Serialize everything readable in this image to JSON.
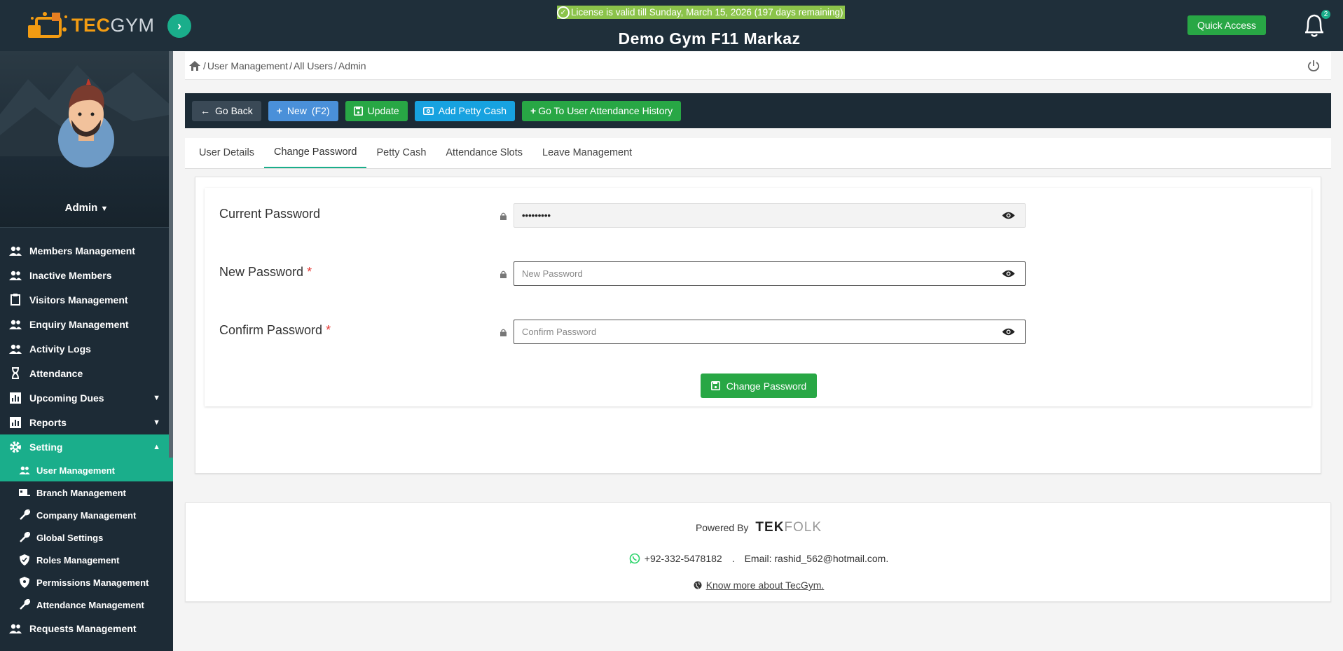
{
  "brand": {
    "logo_tec": "TEC",
    "logo_gym": "GYM",
    "accent": "#1aae8b",
    "orange": "#f39c12"
  },
  "topbar": {
    "license_text": "License is valid till Sunday, March 15, 2026 (197 days remaining)",
    "gym_name": "Demo Gym F11 Markaz",
    "quick_access": "Quick Access",
    "notification_count": "2"
  },
  "sidebar": {
    "user_name": "Admin",
    "items": [
      {
        "label": "Members Management",
        "icon": "users-icon"
      },
      {
        "label": "Inactive Members",
        "icon": "users-icon"
      },
      {
        "label": "Visitors Management",
        "icon": "clipboard-icon"
      },
      {
        "label": "Enquiry Management",
        "icon": "users-icon"
      },
      {
        "label": "Activity Logs",
        "icon": "users-icon"
      },
      {
        "label": "Attendance",
        "icon": "hourglass-icon"
      },
      {
        "label": "Upcoming Dues",
        "icon": "chart-icon"
      },
      {
        "label": "Reports",
        "icon": "chart-icon"
      },
      {
        "label": "Setting",
        "icon": "gear-icon"
      }
    ],
    "sub_items": [
      {
        "label": "User Management",
        "icon": "users-icon"
      },
      {
        "label": "Branch Management",
        "icon": "branch-icon"
      },
      {
        "label": "Company Management",
        "icon": "wrench-icon"
      },
      {
        "label": "Global Settings",
        "icon": "wrench-icon"
      },
      {
        "label": "Roles Management",
        "icon": "shield-icon"
      },
      {
        "label": "Permissions Management",
        "icon": "shield-icon"
      },
      {
        "label": "Attendance Management",
        "icon": "wrench-icon"
      }
    ],
    "last_item": {
      "label": "Requests Management",
      "icon": "users-icon"
    }
  },
  "breadcrumb": [
    "User Management",
    "All Users",
    "Admin"
  ],
  "toolbar": {
    "go_back": "Go Back",
    "new": "New",
    "new_shortcut": "(F2)",
    "update": "Update",
    "petty_cash": "Add Petty Cash",
    "history": "Go To User Attendance History"
  },
  "tabs": [
    "User Details",
    "Change Password",
    "Petty Cash",
    "Attendance Slots",
    "Leave Management"
  ],
  "form": {
    "current_password": {
      "label": "Current Password",
      "value": "•••••••••"
    },
    "new_password": {
      "label": "New Password",
      "placeholder": "New Password"
    },
    "confirm_password": {
      "label": "Confirm Password",
      "placeholder": "Confirm Password"
    },
    "required_mark": "*",
    "submit": "Change Password"
  },
  "footer": {
    "powered_by": "Powered By",
    "tek": "TEK",
    "folk": "FOLK",
    "phone": "+92-332-5478182",
    "dot": ".",
    "email": "Email: rashid_562@hotmail.com.",
    "know_more": "Know more about TecGym."
  }
}
